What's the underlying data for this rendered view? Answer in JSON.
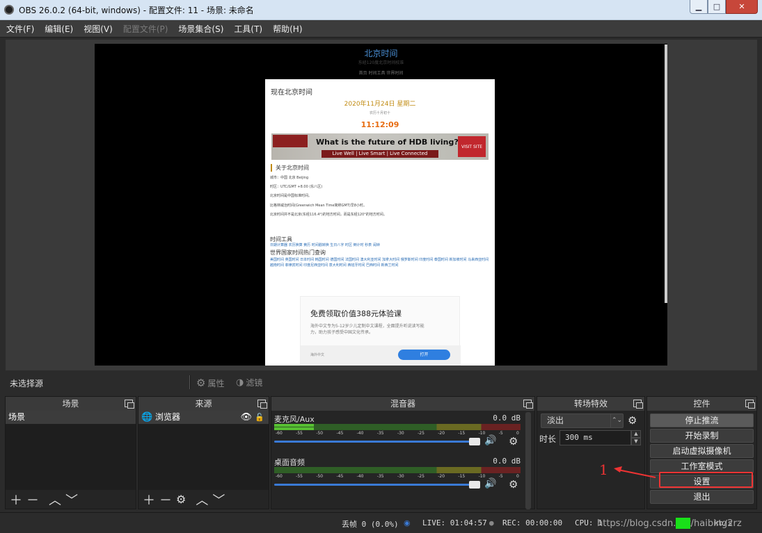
{
  "window": {
    "title": "OBS 26.0.2 (64-bit, windows) - 配置文件: 11 - 场景: 未命名",
    "min": "▁",
    "max": "□",
    "close": "✕"
  },
  "menu": [
    "文件(F)",
    "编辑(E)",
    "视图(V)",
    "配置文件(P)",
    "场景集合(S)",
    "工具(T)",
    "帮助(H)"
  ],
  "preview": {
    "site_title": "北京时间",
    "site_sub": "东经120度北京时间校准",
    "site_nav": "首页    时间工具    世界时间",
    "page_heading": "现在北京时间",
    "date": "2020年11月24日 星期二",
    "lunar": "农历十月初十",
    "clock": "11:12:09",
    "ad_headline": "What is the future of HDB living?",
    "ad_tagline": "Live Well | Live Smart | Live Connected",
    "ad_visit": "VISIT SITE",
    "about_title": "关于北京时间",
    "lines": [
      "城市：中国 北京 Beijing",
      "时区：UTC/GMT +8.00 (东八区)",
      "北京时间是中国标准时间。",
      "比格林威治时间(Greenwich Mean Time简称GMT)早8小时。",
      "北京时间并不是北京(东经116.4°)的地方时间，而是东经120°的地方时间。"
    ],
    "tools_title": "时间工具",
    "tools_links": "日期计算器 农历换算 黄历 时间戳转换 生日八字 时区 倒计时 秒表 闹钟",
    "world_title": "世界国家时间热门查询",
    "world_links": "美国时间 英国时间 日本时间 韩国时间 德国时间 法国时间 澳大利亚时间 加拿大时间 俄罗斯时间 印度时间 泰国时间 新加坡时间 马来西亚时间 越南时间 菲律宾时间 印度尼西亚时间 意大利时间 西班牙时间 巴西时间 新西兰时间",
    "ad2_title": "免费领取价值388元体验课",
    "ad2_desc": "海外中文专为5-12岁少儿定制中文课程，全面提升听说读写能力，助力孩子感受中国文化传承。",
    "ad2_sponsor": "海外中文",
    "ad2_btn": "打开"
  },
  "source_bar": {
    "none_selected": "未选择源",
    "properties": "属性",
    "filters": "滤镜"
  },
  "docks": {
    "scenes": {
      "title": "场景",
      "items": [
        "场景"
      ]
    },
    "sources": {
      "title": "来源",
      "items": [
        "浏览器"
      ]
    },
    "mixer": {
      "title": "混音器",
      "tracks": [
        {
          "name": "麦克风/Aux",
          "db": "0.0 dB",
          "level": 0.16
        },
        {
          "name": "桌面音频",
          "db": "0.0 dB",
          "level": 0.0
        }
      ],
      "scale": [
        "-60",
        "-55",
        "-50",
        "-45",
        "-40",
        "-35",
        "-30",
        "-25",
        "-20",
        "-15",
        "-10",
        "-5",
        "0"
      ]
    },
    "transitions": {
      "title": "转场特效",
      "selected": "淡出",
      "duration_label": "时长",
      "duration": "300 ms"
    },
    "controls": {
      "title": "控件",
      "buttons": [
        "停止推流",
        "开始录制",
        "启动虚拟摄像机",
        "工作室模式",
        "设置",
        "退出"
      ]
    }
  },
  "annotation": {
    "number": "1"
  },
  "status": {
    "dropped": "丢帧 0 (0.0%)",
    "live": "LIVE: 01:04:57",
    "rec": "REC: 00:00:00",
    "cpu": "CPU: 1",
    "watermark": "https://blog.csdn.net/haibing2rz",
    "tail": "kb/s"
  }
}
